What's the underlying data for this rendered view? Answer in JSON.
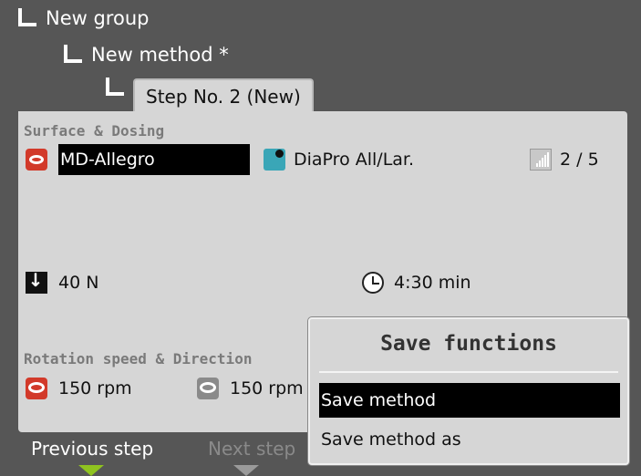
{
  "tree": {
    "group": "New group",
    "method": "New method *",
    "step_tab": "Step No. 2 (New)"
  },
  "surface_dosing": {
    "title": "Surface & Dosing",
    "surface": "MD-Allegro",
    "dosing": "DiaPro All/Lar.",
    "level": "2 / 5",
    "level_value": 2,
    "level_max": 5
  },
  "parameters": {
    "force": "40 N",
    "time": "4:30 min"
  },
  "rotation": {
    "title": "Rotation speed & Direction",
    "disc_speed": "150 rpm",
    "holder_speed": "150 rpm"
  },
  "navigation": {
    "previous": "Previous step",
    "next": "Next step"
  },
  "save_popup": {
    "title": "Save functions",
    "items": [
      "Save method",
      "Save method as"
    ]
  },
  "colors": {
    "background": "#565656",
    "panel": "#d6d6d6",
    "accent_green": "#8fc31f",
    "selection": "#000000",
    "icon_red": "#d23a2a"
  }
}
